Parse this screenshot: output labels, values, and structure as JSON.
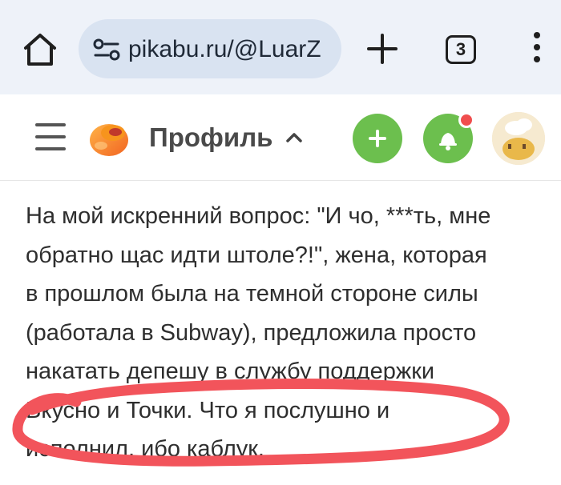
{
  "browser": {
    "url": "pikabu.ru/@LuarZ",
    "tab_count": "3",
    "icons": [
      "home-icon",
      "site-settings-icon",
      "plus-icon",
      "tab-switcher-icon",
      "more-vert-icon"
    ]
  },
  "header": {
    "title": "Профиль",
    "icons": [
      "menu-icon",
      "pikabu-logo",
      "chevron-up-icon",
      "add-post-icon",
      "bell-icon",
      "avatar"
    ]
  },
  "post": {
    "lines": [
      "На мой искренний вопрос: \"И чо, ***ть, мне",
      "обратно щас идти штоле?!\", жена, которая",
      "в прошлом была на темной стороне силы",
      "(работала в Subway), предложила просто",
      "накатать депешу в службу поддержки",
      "Вкусно и Точки. Что я послушно и",
      "исполнил, ибо каблук."
    ]
  },
  "colors": {
    "browser_bg": "#eef2f9",
    "url_pill": "#d9e3f1",
    "accent_green": "#6cbf4e",
    "notification_red": "#f04e4e",
    "scribble_red": "#f2545b"
  }
}
